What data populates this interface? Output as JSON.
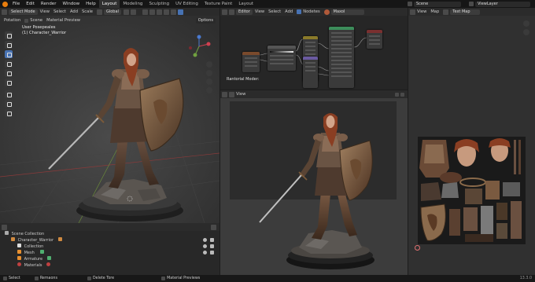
{
  "menu": [
    "File",
    "Edit",
    "Render",
    "Window",
    "Help"
  ],
  "workspaces": [
    "Layout",
    "Modeling",
    "Sculpting",
    "UV Editing",
    "Texture Paint",
    "Layout"
  ],
  "active_workspace_index": 0,
  "scene": "Scene",
  "view_layer": "ViewLayer",
  "viewport3d": {
    "mode": "Select Mode",
    "menus": [
      "View",
      "Select",
      "Add",
      "Scale"
    ],
    "orientation": "Global",
    "sub_items": [
      "Potation",
      "Scene",
      "Material Preview"
    ],
    "options": "Options",
    "overlay_title": "User Posepeales",
    "overlay_object": "(1) Character_Warrior"
  },
  "node_editor": {
    "editor": "Editor",
    "menus": [
      "View",
      "Select",
      "Add"
    ],
    "nodes_label": "Nodetes",
    "material": "Maxol",
    "label": "Rantorial Moder:"
  },
  "render_view": {
    "label": "View"
  },
  "image_editor": {
    "menus": [
      "View",
      "Map"
    ],
    "image": "Text Map"
  },
  "outliner": {
    "title": "Scene Collection",
    "items": [
      {
        "label": "Character_Warrior",
        "level": 0
      },
      {
        "label": "Collection",
        "level": 1
      },
      {
        "label": "Mesh",
        "level": 1
      },
      {
        "label": "Armature",
        "level": 1
      },
      {
        "label": "Materials",
        "level": 1
      }
    ]
  },
  "statusbar": {
    "items": [
      "Select",
      "Remaons",
      "Delete Tore",
      "Material Previews"
    ],
    "version": "13.3.0"
  },
  "colors": {
    "accent": "#4772b3",
    "header": "#2b2b2b",
    "node_green": "#3c8c5a",
    "node_orange": "#b56c2c",
    "node_purple": "#7060b0"
  }
}
